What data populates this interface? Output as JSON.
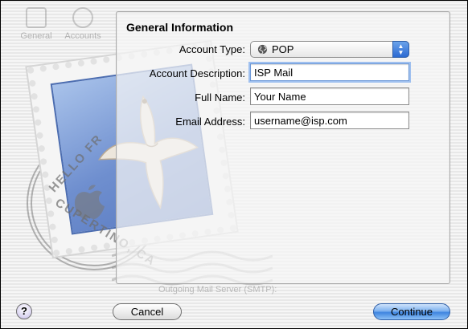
{
  "toolbar_ghost": {
    "items": [
      "General",
      "Accounts"
    ]
  },
  "stamp": {
    "text_top": "HELLO FR",
    "text_bottom": "CUPERTINO, CA"
  },
  "panel": {
    "title": "General Information",
    "fields": {
      "account_type": {
        "label": "Account Type:",
        "value": "POP",
        "icon": "globe-icon"
      },
      "account_description": {
        "label": "Account Description:",
        "value": "ISP Mail"
      },
      "full_name": {
        "label": "Full Name:",
        "value": "Your Name"
      },
      "email_address": {
        "label": "Email Address:",
        "value": "username@isp.com"
      }
    }
  },
  "ghost_bottom": {
    "outgoing": "Outgoing Mail Server (SMTP):"
  },
  "buttons": {
    "help": "?",
    "cancel": "Cancel",
    "continue": "Continue"
  },
  "colors": {
    "default_button": "#3e85e0",
    "focus_ring": "#9fc0ef",
    "stamp_blue": "#6f8fcf"
  }
}
